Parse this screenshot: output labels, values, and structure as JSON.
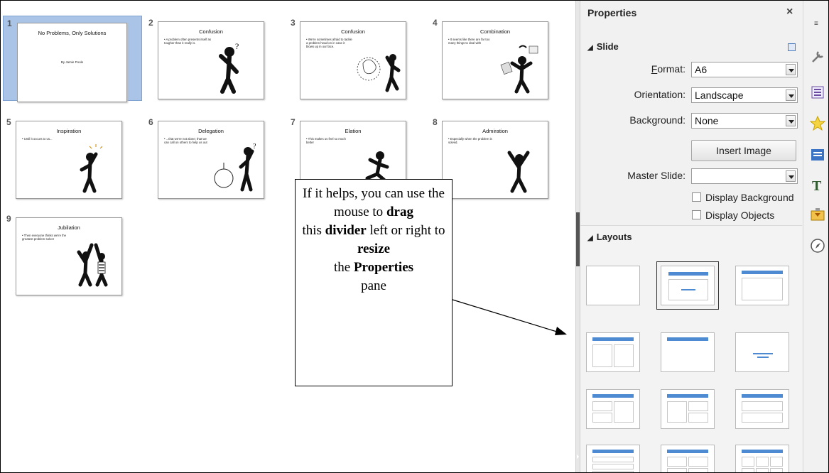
{
  "slides": [
    {
      "number": "1",
      "title": "No Problems, Only Solutions",
      "subtitle": "By Jamie Poole",
      "bullet": "",
      "art": "none"
    },
    {
      "number": "2",
      "title": "Confusion",
      "subtitle": "",
      "bullet": "A problem often presents itself as tougher than it really is.",
      "art": "question-man"
    },
    {
      "number": "3",
      "title": "Confusion",
      "subtitle": "",
      "bullet": "We're sometimes afraid to tackle a problem head-on in case it blows up in our face.",
      "art": "explosion-man"
    },
    {
      "number": "4",
      "title": "Combination",
      "subtitle": "",
      "bullet": "It seems like there are far too many things to deal with",
      "art": "juggling-man"
    },
    {
      "number": "5",
      "title": "Inspiration",
      "subtitle": "",
      "bullet": "Until it occurs to us...",
      "art": "idea-man"
    },
    {
      "number": "6",
      "title": "Delegation",
      "subtitle": "",
      "bullet": "...that we're not alone; that we can call on others to help us out",
      "art": "bomb-man"
    },
    {
      "number": "7",
      "title": "Elation",
      "subtitle": "",
      "bullet": "This makes us feel so much better",
      "art": "jumping-man"
    },
    {
      "number": "8",
      "title": "Admiration",
      "subtitle": "",
      "bullet": "Especially when the problem is solved.",
      "art": "cheering-man"
    },
    {
      "number": "9",
      "title": "Jubilation",
      "subtitle": "",
      "bullet": "Then everyone thinks we're the greatest problem-solver",
      "art": "high-five-men"
    }
  ],
  "properties": {
    "title": "Properties",
    "close_glyph": "×",
    "slide_section": "Slide",
    "format_label": "Format:",
    "format_value": "A6",
    "orientation_label": "Orientation:",
    "orientation_value": "Landscape",
    "background_label": "Background:",
    "background_value": "None",
    "insert_image": "Insert Image",
    "master_label": "Master Slide:",
    "master_value": "",
    "display_background": "Display Background",
    "display_objects": "Display Objects",
    "layouts_section": "Layouts",
    "selected_layout_index": 1
  },
  "callout": {
    "p1": "If it helps, you can use the mouse to",
    "b1": "drag",
    "p2": "this",
    "b2": "divider",
    "p3": "left or right to",
    "b3": "resize",
    "p4": "the",
    "b4": "Properties",
    "p5": "pane"
  },
  "sidebar_tabs": [
    "properties-icon",
    "styles-icon",
    "gallery-icon",
    "navigator-icon",
    "fontwork-icon",
    "slide-transition-icon",
    "compass-icon"
  ],
  "colors": {
    "accent": "#4d8ad2",
    "selected_slide": "#a9c4e6"
  }
}
